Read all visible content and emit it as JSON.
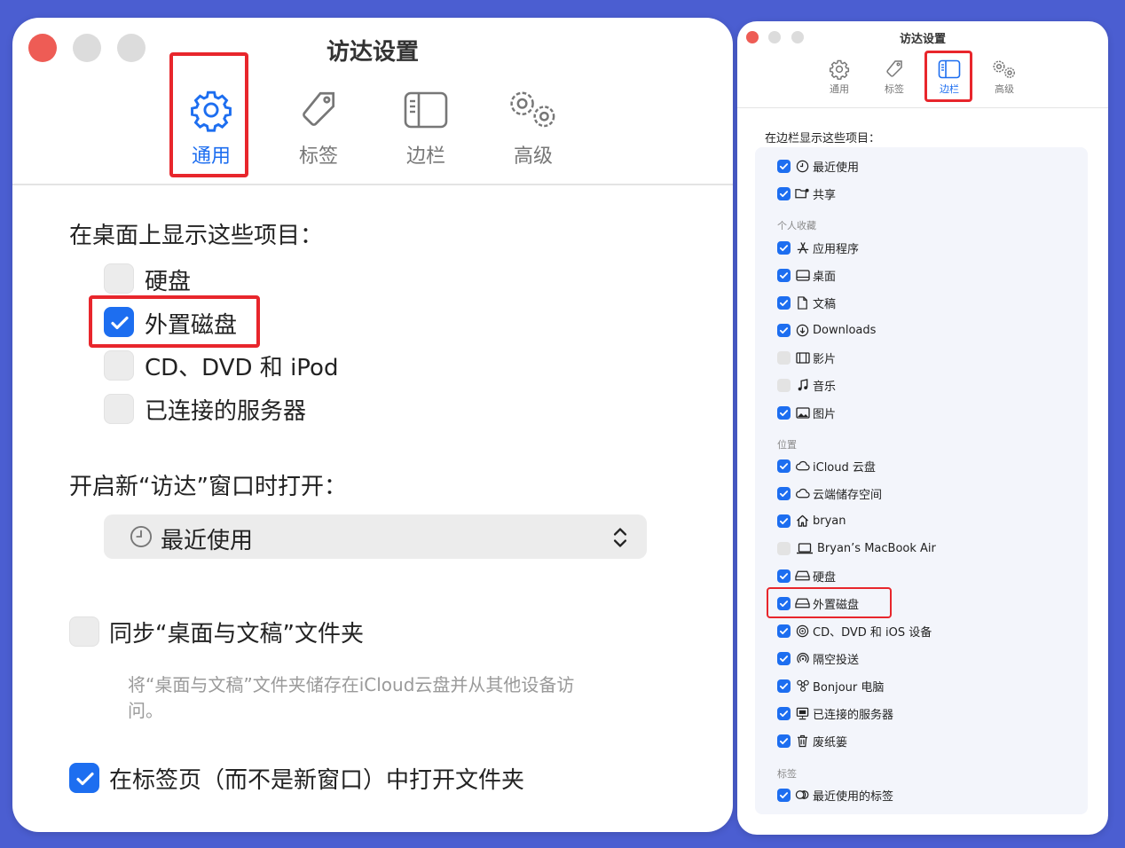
{
  "general_window": {
    "title": "访达设置",
    "tabs": [
      {
        "label": "通用",
        "icon": "gear-icon",
        "selected": true
      },
      {
        "label": "标签",
        "icon": "tag-icon",
        "selected": false
      },
      {
        "label": "边栏",
        "icon": "sidebar-icon",
        "selected": false
      },
      {
        "label": "高级",
        "icon": "gears-icon",
        "selected": false
      }
    ],
    "desktop_heading": "在桌面上显示这些项目：",
    "desktop_items": [
      {
        "label": "硬盘",
        "checked": false
      },
      {
        "label": "外置磁盘",
        "checked": true
      },
      {
        "label": "CD、DVD 和 iPod",
        "checked": false
      },
      {
        "label": "已连接的服务器",
        "checked": false
      }
    ],
    "new_window_label": "开启新“访达”窗口时打开：",
    "new_window_value": "最近使用",
    "sync_label": "同步“桌面与文稿”文件夹",
    "sync_checked": false,
    "sync_note": "将“桌面与文稿”文件夹储存在iCloud云盘并从其他设备访问。",
    "tabs_label": "在标签页（而不是新窗口）中打开文件夹",
    "tabs_checked": true
  },
  "sidebar_window": {
    "title": "访达设置",
    "tabs": [
      {
        "label": "通用",
        "icon": "gear-icon",
        "selected": false
      },
      {
        "label": "标签",
        "icon": "tag-icon",
        "selected": false
      },
      {
        "label": "边栏",
        "icon": "sidebar-icon",
        "selected": true
      },
      {
        "label": "高级",
        "icon": "gears-icon",
        "selected": false
      }
    ],
    "heading": "在边栏显示这些项目：",
    "top_items": [
      {
        "label": "最近使用",
        "icon": "clock-icon",
        "checked": true
      },
      {
        "label": "共享",
        "icon": "shared-folder-icon",
        "checked": true
      }
    ],
    "favorites_header": "个人收藏",
    "favorites": [
      {
        "label": "应用程序",
        "icon": "applications-icon",
        "checked": true
      },
      {
        "label": "桌面",
        "icon": "desktop-icon",
        "checked": true
      },
      {
        "label": "文稿",
        "icon": "document-icon",
        "checked": true
      },
      {
        "label": "Downloads",
        "icon": "download-icon",
        "checked": true
      },
      {
        "label": "影片",
        "icon": "film-icon",
        "checked": false
      },
      {
        "label": "音乐",
        "icon": "music-icon",
        "checked": false
      },
      {
        "label": "图片",
        "icon": "photo-icon",
        "checked": true
      }
    ],
    "locations_header": "位置",
    "locations": [
      {
        "label": "iCloud 云盘",
        "icon": "cloud-icon",
        "checked": true
      },
      {
        "label": "云端储存空间",
        "icon": "cloud-icon",
        "checked": true
      },
      {
        "label": "bryan",
        "icon": "home-icon",
        "checked": true
      },
      {
        "label": "Bryan’s MacBook Air",
        "icon": "laptop-icon",
        "checked": false
      },
      {
        "label": "硬盘",
        "icon": "drive-icon",
        "checked": true
      },
      {
        "label": "外置磁盘",
        "icon": "drive-icon",
        "checked": true
      },
      {
        "label": "CD、DVD 和 iOS 设备",
        "icon": "disc-icon",
        "checked": true
      },
      {
        "label": "隔空投送",
        "icon": "airdrop-icon",
        "checked": true
      },
      {
        "label": "Bonjour 电脑",
        "icon": "bonjour-icon",
        "checked": true
      },
      {
        "label": "已连接的服务器",
        "icon": "server-icon",
        "checked": true
      },
      {
        "label": "废纸篓",
        "icon": "trash-icon",
        "checked": true
      }
    ],
    "tags_header": "标签",
    "tags": [
      {
        "label": "最近使用的标签",
        "icon": "tags-icon",
        "checked": true
      }
    ]
  },
  "colors": {
    "accent": "#1d6ef0",
    "highlight_box": "#e8262c",
    "background": "#4b5ed1",
    "traffic_close": "#ee5c55",
    "traffic_inactive": "#dcdcdc"
  }
}
